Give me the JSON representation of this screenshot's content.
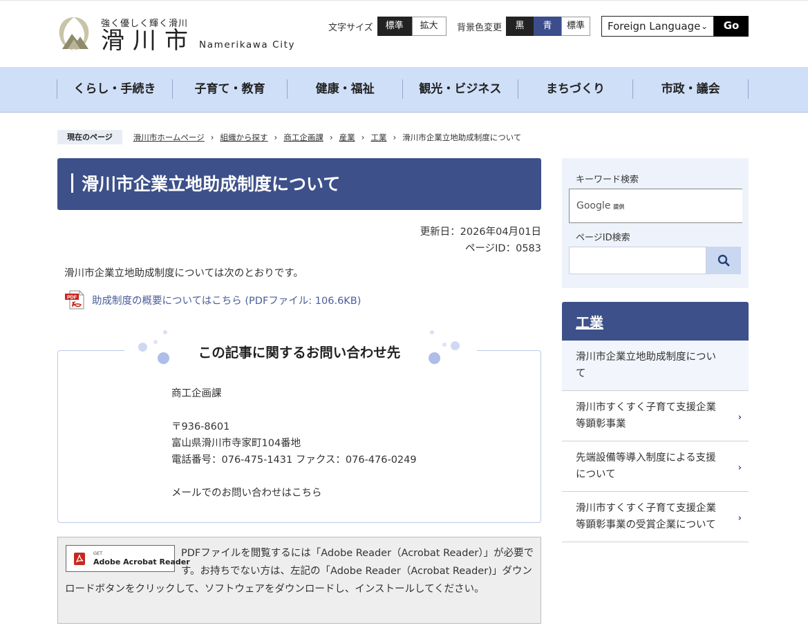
{
  "header": {
    "tagline": "強く優しく輝く滑川",
    "city_name": "滑川市",
    "city_en": "Namerikawa City",
    "font_size_label": "文字サイズ",
    "font_standard": "標準",
    "font_large": "拡大",
    "bg_label": "背景色変更",
    "bg_black": "黒",
    "bg_blue": "青",
    "bg_standard": "標準",
    "language_select": "Foreign Language",
    "go_button": "Go"
  },
  "gnav": [
    "くらし・手続き",
    "子育て・教育",
    "健康・福祉",
    "観光・ビジネス",
    "まちづくり",
    "市政・議会"
  ],
  "breadcrumb": {
    "label": "現在のページ",
    "items": [
      "滑川市ホームページ",
      "組織から探す",
      "商工企画課",
      "産業",
      "工業"
    ],
    "current": "滑川市企業立地助成制度について",
    "separator": "›"
  },
  "main": {
    "title": "滑川市企業立地助成制度について",
    "updated": "更新日：2026年04月01日",
    "page_id": "ページID：0583",
    "intro": "滑川市企業立地助成制度については次のとおりです。",
    "pdf_link": "助成制度の概要についてはこちら (PDFファイル: 106.6KB)"
  },
  "contact": {
    "title": "この記事に関するお問い合わせ先",
    "department": "商工企画課",
    "postal": "〒936-8601",
    "address": "富山県滑川市寺家町104番地",
    "phone": "電話番号：076-475-1431 ファクス：076-476-0249",
    "mail_link": "メールでのお問い合わせはこちら"
  },
  "adobe": {
    "badge_get": "GET",
    "badge_name": "Adobe Acrobat Reader",
    "text": "PDFファイルを閲覧するには「Adobe Reader（Acrobat Reader）」が必要です。お持ちでない方は、左記の「Adobe Reader（Acrobat Reader)」ダウンロードボタンをクリックして、ソフトウェアをダウンロードし、インストールしてください。"
  },
  "sidebar": {
    "keyword_label": "キーワード検索",
    "google_label": "Google",
    "google_sub": "提供",
    "pageid_label": "ページID検索",
    "search_icon": "search-icon",
    "section_title": "工業",
    "items": [
      "滑川市企業立地助成制度について",
      "滑川市すくすく子育て支援企業等顕彰事業",
      "先端設備等導入制度による支援について",
      "滑川市すくすく子育て支援企業等顕彰事業の受賞企業について"
    ],
    "arrow": "›"
  },
  "colors": {
    "title_bg": "#3d5089",
    "nav_bg": "#cfdff7",
    "link": "#4a5d99",
    "search_bg": "#eef3fb"
  }
}
